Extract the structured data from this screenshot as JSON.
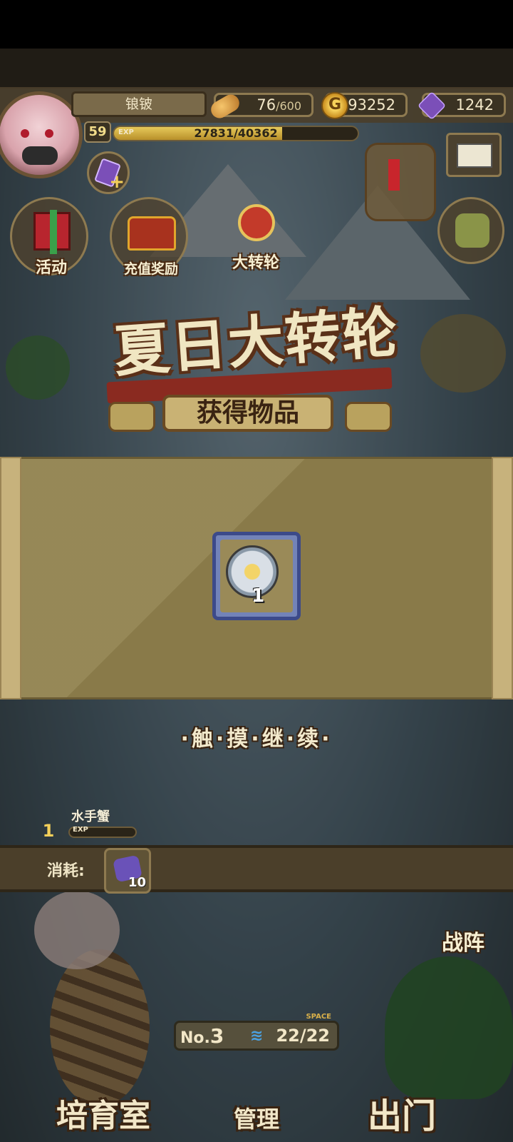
{
  "player": {
    "name": "锒铍",
    "level": "59",
    "exp_tag": "EXP",
    "exp_text": "27831/40362",
    "exp_fraction": 0.6895
  },
  "resources": {
    "stamina_value": "76",
    "stamina_max": "/600",
    "gold_symbol": "G",
    "gold": "93252",
    "gems": "1242"
  },
  "menu": {
    "activity": "活动",
    "recharge_reward": "充值奖励",
    "big_wheel": "大转轮",
    "gem_plus": "+"
  },
  "event": {
    "title": "夏日大转轮",
    "obtained_header": "获得物品"
  },
  "reward": {
    "quantity": "1",
    "icon": "sun-medal-icon"
  },
  "prompt": {
    "touch_continue": "·触·摸·继·续·"
  },
  "monster": {
    "name": "水手蟹",
    "level": "1",
    "exp_tag": "EXP"
  },
  "consume": {
    "label": "消耗:",
    "quantity": "10"
  },
  "battle": {
    "label": "战阵"
  },
  "storage": {
    "no_label": "No.",
    "no_value": "3",
    "space_tag": "SPACE",
    "count": "22/22"
  },
  "bottom_nav": {
    "nursery": "培育室",
    "manage": "管理",
    "exit": "出门"
  },
  "colors": {
    "accent_gold": "#f5d05a",
    "gem_purple": "#7b4fb8",
    "reward_frame_blue": "#3c4a8a"
  }
}
